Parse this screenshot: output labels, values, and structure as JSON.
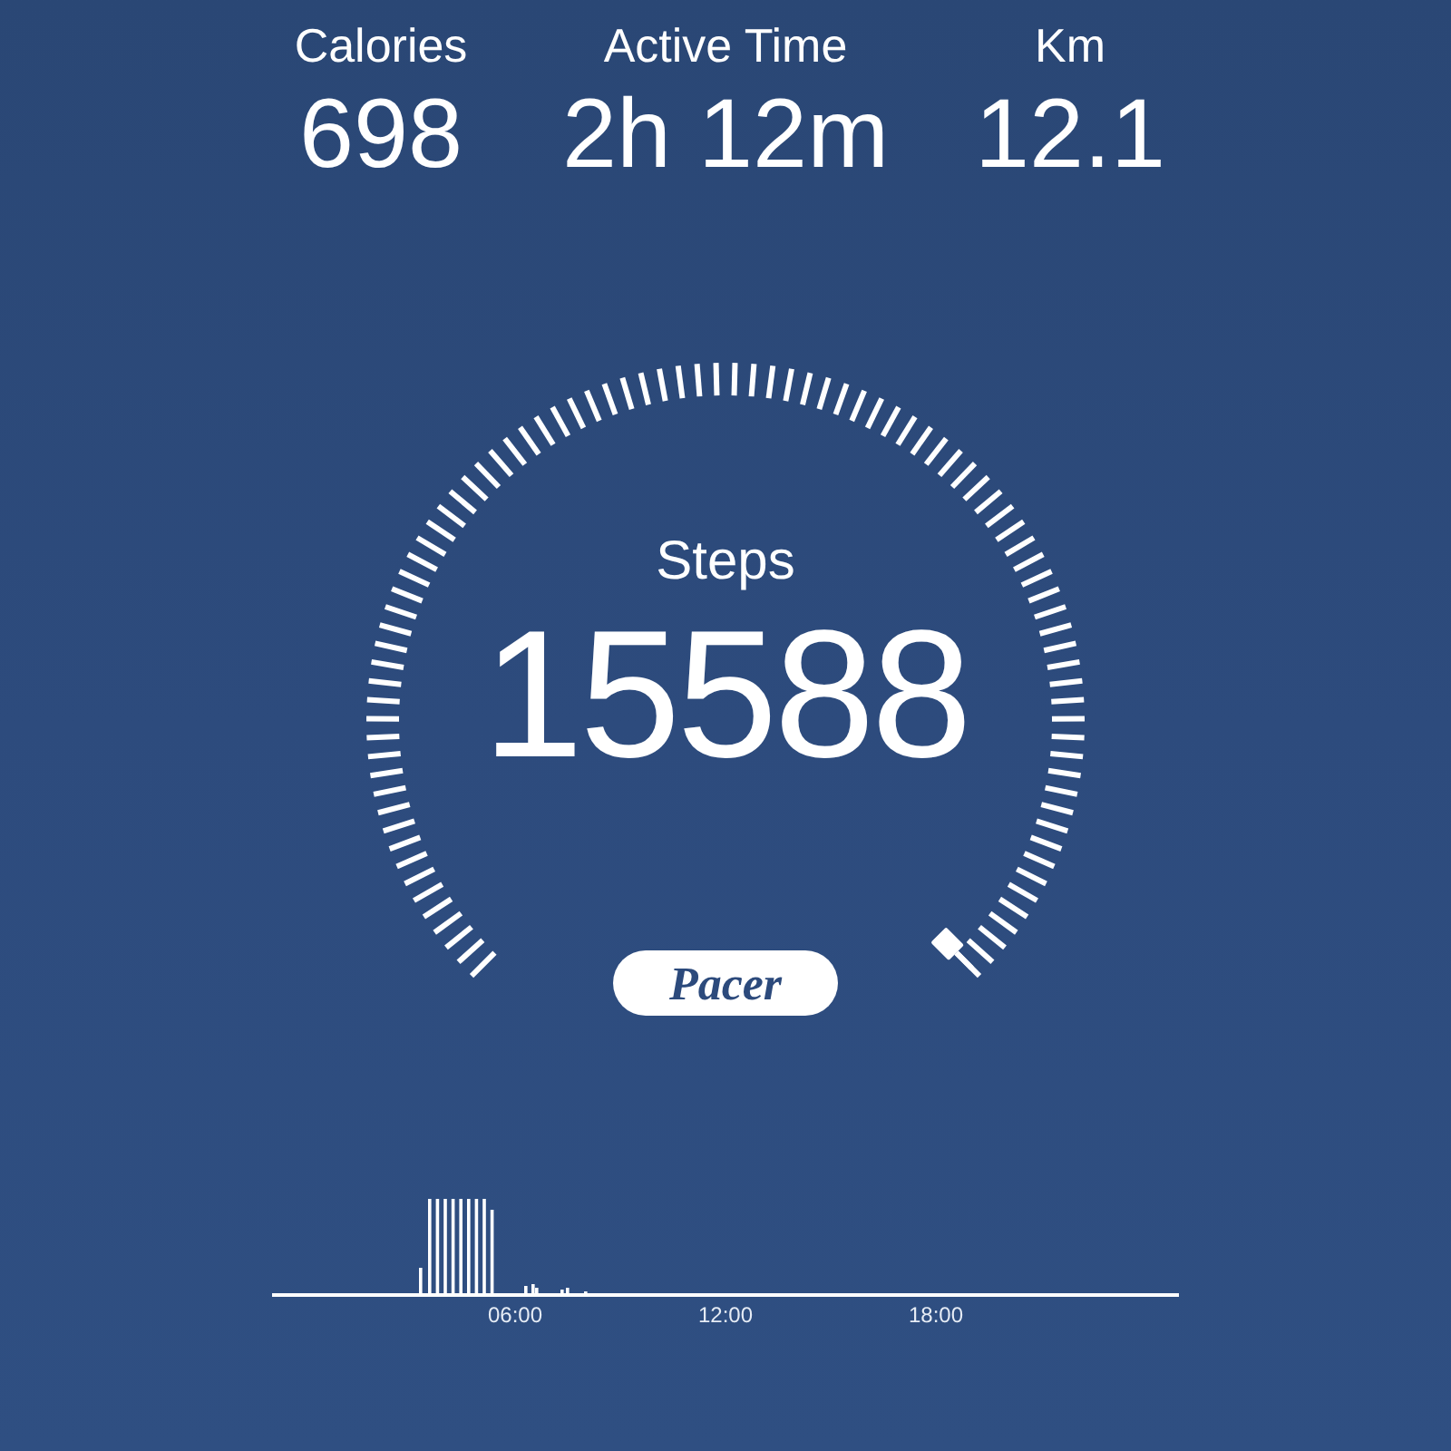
{
  "stats": [
    {
      "label": "Calories",
      "value": "698"
    },
    {
      "label": "Active Time",
      "value": "2h 12m"
    },
    {
      "label": "Km",
      "value": "12.1"
    }
  ],
  "gauge": {
    "label": "Steps",
    "value": "15588"
  },
  "badge": {
    "text": "Pacer"
  },
  "activity_chart": {
    "xticks": [
      "06:00",
      "12:00",
      "18:00"
    ]
  }
}
